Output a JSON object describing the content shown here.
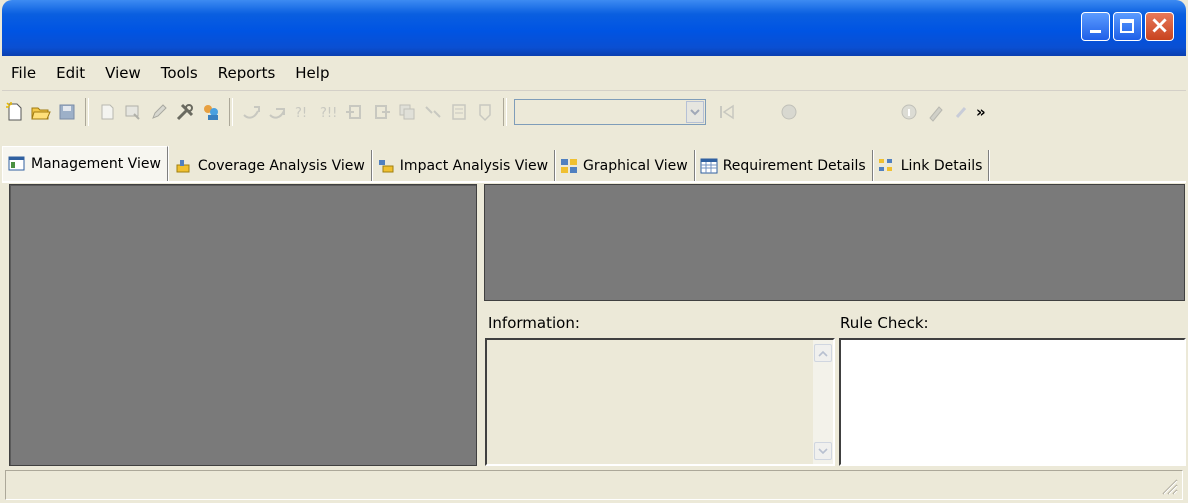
{
  "window": {
    "title": ""
  },
  "menubar": {
    "items": [
      "File",
      "Edit",
      "View",
      "Tools",
      "Reports",
      "Help"
    ]
  },
  "toolbar": {
    "overflow_label": "»",
    "combo_value": ""
  },
  "tabs": [
    {
      "label": "Management View",
      "icon": "management-view-icon",
      "active": true
    },
    {
      "label": "Coverage Analysis View",
      "icon": "coverage-analysis-icon",
      "active": false
    },
    {
      "label": "Impact Analysis View",
      "icon": "impact-analysis-icon",
      "active": false
    },
    {
      "label": "Graphical View",
      "icon": "graphical-view-icon",
      "active": false
    },
    {
      "label": "Requirement Details",
      "icon": "requirement-details-icon",
      "active": false
    },
    {
      "label": "Link Details",
      "icon": "link-details-icon",
      "active": false
    }
  ],
  "panels": {
    "information_label": "Information:",
    "rule_check_label": "Rule Check:"
  },
  "colors": {
    "titlebar": "#0054e3",
    "panel_gray": "#7a7a7a",
    "face": "#ece9d8"
  }
}
